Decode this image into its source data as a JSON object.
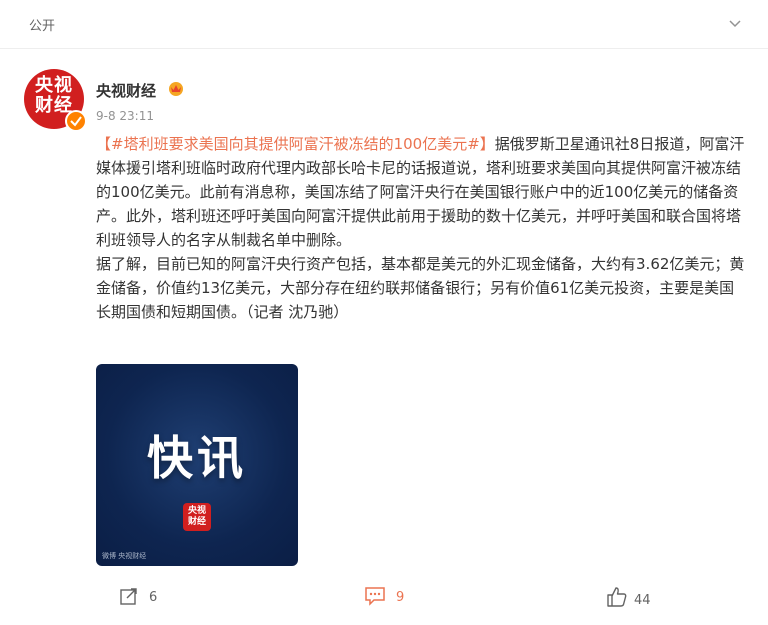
{
  "topbar": {
    "visibility": "公开"
  },
  "author": {
    "avatar_text": "央视\n财经",
    "name": "央视财经",
    "time": "9-8 23:11"
  },
  "post": {
    "hashtag": "【#塔利班要求美国向其提供阿富汗被冻结的100亿美元#】",
    "body1": "据俄罗斯卫星通讯社8日报道，阿富汗媒体援引塔利班临时政府代理内政部长哈卡尼的话报道说，塔利班要求美国向其提供阿富汗被冻结的100亿美元。此前有消息称，美国冻结了阿富汗央行在美国银行账户中的近100亿美元的储备资产。此外，塔利班还呼吁美国向阿富汗提供此前用于援助的数十亿美元，并呼吁美国和联合国将塔利班领导人的名字从制裁名单中删除。",
    "body2": "据了解，目前已知的阿富汗央行资产包括，基本都是美元的外汇现金储备，大约有3.62亿美元；黄金储备，价值约13亿美元，大部分存在纽约联邦储备银行；另有价值61亿美元投资，主要是美国长期国债和短期国债。（记者 沈乃驰）"
  },
  "image": {
    "title": "快讯",
    "logo_text": "央视\n财经",
    "watermark": "微博 央视财经"
  },
  "actions": {
    "repost_count": "6",
    "comment_count": "9",
    "like_count": "44"
  },
  "colors": {
    "accent": "#eb7350",
    "brand_red": "#d11f1f",
    "verified": "#ff8200",
    "image_bg": "#0e2550"
  }
}
